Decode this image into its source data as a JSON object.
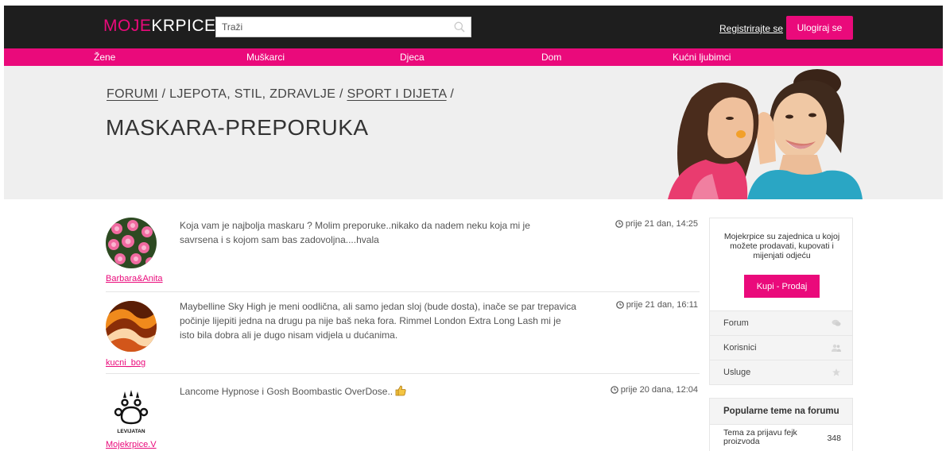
{
  "header": {
    "logo_part1": "MOJE",
    "logo_part2": "KRPICE",
    "search_placeholder": "Traži",
    "register_label": "Registrirajte se",
    "login_label": "Ulogiraj se"
  },
  "nav": {
    "items": [
      "Žene",
      "Muškarci",
      "Djeca",
      "Dom",
      "Kućni ljubimci"
    ]
  },
  "breadcrumb": {
    "items": [
      {
        "label": "FORUMI",
        "link": true
      },
      {
        "label": "LJEPOTA, STIL, ZDRAVLJE",
        "link": false
      },
      {
        "label": "SPORT I DIJETA",
        "link": true
      }
    ],
    "separator": "/"
  },
  "page_title": "MASKARA-PREPORUKA",
  "posts": [
    {
      "username": "Barbara&Anita",
      "text": "Koja vam je najbolja maskaru ? Molim preporuke..nikako da nadem neku koja mi je savrsena i s kojom sam bas zadovoljna....hvala",
      "time": "prije 21 dan, 14:25"
    },
    {
      "username": "kucni_bog",
      "text": "Maybelline Sky High je meni oodlična, ali samo jedan sloj (bude dosta), inače se par trepavica počinje lijepiti jedna na drugu pa nije baš neka fora. Rimmel London Extra Long Lash mi je isto bila dobra ali je dugo nisam vidjela u dućanima.",
      "time": "prije 21 dan, 16:11"
    },
    {
      "username": "Mojekrpice.V",
      "text": "Lancome Hypnose i Gosh Boombastic OverDose..",
      "time": "prije 20 dana, 12:04",
      "avatar_text": "LEVIJATAN"
    }
  ],
  "sidebar": {
    "description": "Mojekrpice su zajednica u kojoj možete prodavati, kupovati i mijenjati odjeću",
    "button_label": "Kupi - Prodaj",
    "menu": [
      {
        "label": "Forum",
        "icon": "chat-icon"
      },
      {
        "label": "Korisnici",
        "icon": "users-icon"
      },
      {
        "label": "Usluge",
        "icon": "star-icon"
      }
    ],
    "popular_heading": "Popularne teme na forumu",
    "popular_topics": [
      {
        "title": "Tema za prijavu fejk proizvoda",
        "count": "348"
      }
    ]
  },
  "colors": {
    "accent": "#ea0a7b",
    "topbar": "#1e1e1e",
    "hero_bg": "#efefef"
  }
}
